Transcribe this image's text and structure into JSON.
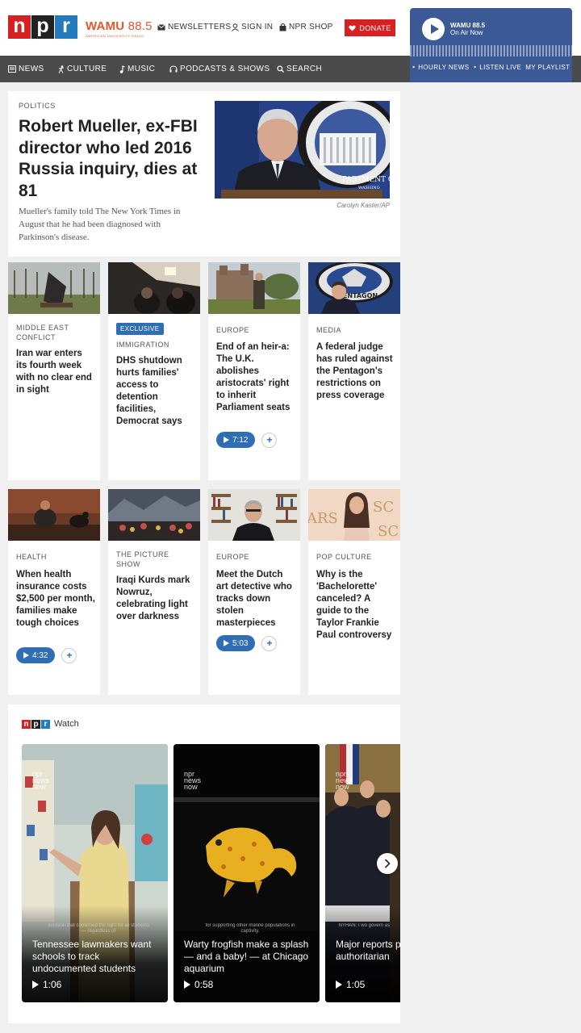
{
  "header": {
    "station_name": "WAMU",
    "station_freq": "88.5",
    "station_sub": "AMERICAN UNIVERSITY RADIO",
    "links": [
      "NEWSLETTERS",
      "SIGN IN",
      "NPR SHOP"
    ],
    "donate": "DONATE"
  },
  "player": {
    "station": "WAMU 88.5",
    "status": "On Air Now",
    "links": [
      "HOURLY NEWS",
      "LISTEN LIVE",
      "MY PLAYLIST"
    ]
  },
  "nav": [
    "NEWS",
    "CULTURE",
    "MUSIC",
    "PODCASTS & SHOWS",
    "SEARCH"
  ],
  "lead": {
    "kicker": "POLITICS",
    "title": "Robert Mueller, ex-FBI director who led 2016 Russia inquiry, dies at 81",
    "teaser": "Mueller's family told The New York Times in August that he had been diagnosed with Parkinson's disease.",
    "credit": "Carolyn Kaster/AP",
    "image_sign": "PARTMENT O\nWASHING"
  },
  "cards": [
    {
      "kicker": "MIDDLE EAST CONFLICT",
      "title": "Iran war enters its fourth week with no clear end in sight"
    },
    {
      "badge": "EXCLUSIVE",
      "kicker": "IMMIGRATION",
      "title": "DHS shutdown hurts families' access to detention facilities, Democrat says"
    },
    {
      "kicker": "EUROPE",
      "title": "End of an heir-a: The U.K. abolishes aristocrats' right to inherit Parliament seats",
      "duration": "7:12"
    },
    {
      "kicker": "MEDIA",
      "title": "A federal judge has ruled against the Pentagon's restrictions on press coverage",
      "image_sign": "PENTAGON"
    },
    {
      "kicker": "HEALTH",
      "title": "When health insurance costs $2,500 per month, families make tough choices",
      "duration": "4:32"
    },
    {
      "kicker": "THE PICTURE SHOW",
      "title": "Iraqi Kurds mark Nowruz, celebrating light over darkness"
    },
    {
      "kicker": "EUROPE",
      "title": "Meet the Dutch art detective who tracks down stolen masterpieces",
      "duration": "5:03"
    },
    {
      "kicker": "POP CULTURE",
      "title": "Why is the 'Bachelorette' canceled? A guide to the Taylor Frankie Paul controversy",
      "image_sign": "ARS"
    }
  ],
  "watch": {
    "label": "Watch",
    "brand": "npr\nnews\nnow",
    "videos": [
      {
        "title": "Tennessee lawmakers want schools to track undocumented students",
        "duration": "1:06",
        "caption": "decision that confirmed the right for all students — regardless of"
      },
      {
        "title": "Warty frogfish make a splash — and a baby! — at Chicago aquarium",
        "duration": "0:58",
        "caption": "for supporting other marine populations in captivity."
      },
      {
        "title": "Major reports pushing the authoritarian",
        "duration": "1:05",
        "caption": "NYHAN: I wo govern as"
      }
    ]
  },
  "colors": {
    "npr_red": "#d62021",
    "npr_black": "#222222",
    "npr_blue": "#237bbd",
    "wamu_orange": "#e4572e",
    "player_blue": "#3a5995",
    "nav_gray": "#4a4a4a",
    "accent_blue": "#2f6db4"
  }
}
